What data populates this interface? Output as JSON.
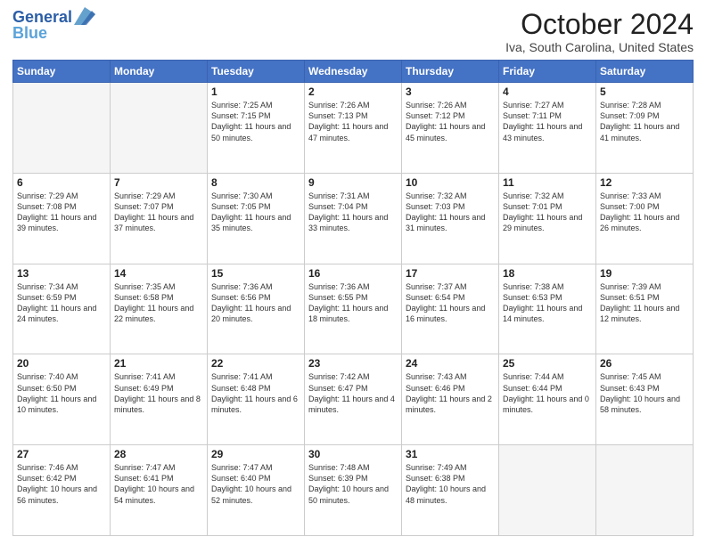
{
  "header": {
    "logo_line1": "General",
    "logo_line2": "Blue",
    "title": "October 2024",
    "subtitle": "Iva, South Carolina, United States"
  },
  "days_of_week": [
    "Sunday",
    "Monday",
    "Tuesday",
    "Wednesday",
    "Thursday",
    "Friday",
    "Saturday"
  ],
  "weeks": [
    [
      {
        "day": "",
        "sunrise": "",
        "sunset": "",
        "daylight": "",
        "empty": true
      },
      {
        "day": "",
        "sunrise": "",
        "sunset": "",
        "daylight": "",
        "empty": true
      },
      {
        "day": "1",
        "sunrise": "Sunrise: 7:25 AM",
        "sunset": "Sunset: 7:15 PM",
        "daylight": "Daylight: 11 hours and 50 minutes."
      },
      {
        "day": "2",
        "sunrise": "Sunrise: 7:26 AM",
        "sunset": "Sunset: 7:13 PM",
        "daylight": "Daylight: 11 hours and 47 minutes."
      },
      {
        "day": "3",
        "sunrise": "Sunrise: 7:26 AM",
        "sunset": "Sunset: 7:12 PM",
        "daylight": "Daylight: 11 hours and 45 minutes."
      },
      {
        "day": "4",
        "sunrise": "Sunrise: 7:27 AM",
        "sunset": "Sunset: 7:11 PM",
        "daylight": "Daylight: 11 hours and 43 minutes."
      },
      {
        "day": "5",
        "sunrise": "Sunrise: 7:28 AM",
        "sunset": "Sunset: 7:09 PM",
        "daylight": "Daylight: 11 hours and 41 minutes."
      }
    ],
    [
      {
        "day": "6",
        "sunrise": "Sunrise: 7:29 AM",
        "sunset": "Sunset: 7:08 PM",
        "daylight": "Daylight: 11 hours and 39 minutes."
      },
      {
        "day": "7",
        "sunrise": "Sunrise: 7:29 AM",
        "sunset": "Sunset: 7:07 PM",
        "daylight": "Daylight: 11 hours and 37 minutes."
      },
      {
        "day": "8",
        "sunrise": "Sunrise: 7:30 AM",
        "sunset": "Sunset: 7:05 PM",
        "daylight": "Daylight: 11 hours and 35 minutes."
      },
      {
        "day": "9",
        "sunrise": "Sunrise: 7:31 AM",
        "sunset": "Sunset: 7:04 PM",
        "daylight": "Daylight: 11 hours and 33 minutes."
      },
      {
        "day": "10",
        "sunrise": "Sunrise: 7:32 AM",
        "sunset": "Sunset: 7:03 PM",
        "daylight": "Daylight: 11 hours and 31 minutes."
      },
      {
        "day": "11",
        "sunrise": "Sunrise: 7:32 AM",
        "sunset": "Sunset: 7:01 PM",
        "daylight": "Daylight: 11 hours and 29 minutes."
      },
      {
        "day": "12",
        "sunrise": "Sunrise: 7:33 AM",
        "sunset": "Sunset: 7:00 PM",
        "daylight": "Daylight: 11 hours and 26 minutes."
      }
    ],
    [
      {
        "day": "13",
        "sunrise": "Sunrise: 7:34 AM",
        "sunset": "Sunset: 6:59 PM",
        "daylight": "Daylight: 11 hours and 24 minutes."
      },
      {
        "day": "14",
        "sunrise": "Sunrise: 7:35 AM",
        "sunset": "Sunset: 6:58 PM",
        "daylight": "Daylight: 11 hours and 22 minutes."
      },
      {
        "day": "15",
        "sunrise": "Sunrise: 7:36 AM",
        "sunset": "Sunset: 6:56 PM",
        "daylight": "Daylight: 11 hours and 20 minutes."
      },
      {
        "day": "16",
        "sunrise": "Sunrise: 7:36 AM",
        "sunset": "Sunset: 6:55 PM",
        "daylight": "Daylight: 11 hours and 18 minutes."
      },
      {
        "day": "17",
        "sunrise": "Sunrise: 7:37 AM",
        "sunset": "Sunset: 6:54 PM",
        "daylight": "Daylight: 11 hours and 16 minutes."
      },
      {
        "day": "18",
        "sunrise": "Sunrise: 7:38 AM",
        "sunset": "Sunset: 6:53 PM",
        "daylight": "Daylight: 11 hours and 14 minutes."
      },
      {
        "day": "19",
        "sunrise": "Sunrise: 7:39 AM",
        "sunset": "Sunset: 6:51 PM",
        "daylight": "Daylight: 11 hours and 12 minutes."
      }
    ],
    [
      {
        "day": "20",
        "sunrise": "Sunrise: 7:40 AM",
        "sunset": "Sunset: 6:50 PM",
        "daylight": "Daylight: 11 hours and 10 minutes."
      },
      {
        "day": "21",
        "sunrise": "Sunrise: 7:41 AM",
        "sunset": "Sunset: 6:49 PM",
        "daylight": "Daylight: 11 hours and 8 minutes."
      },
      {
        "day": "22",
        "sunrise": "Sunrise: 7:41 AM",
        "sunset": "Sunset: 6:48 PM",
        "daylight": "Daylight: 11 hours and 6 minutes."
      },
      {
        "day": "23",
        "sunrise": "Sunrise: 7:42 AM",
        "sunset": "Sunset: 6:47 PM",
        "daylight": "Daylight: 11 hours and 4 minutes."
      },
      {
        "day": "24",
        "sunrise": "Sunrise: 7:43 AM",
        "sunset": "Sunset: 6:46 PM",
        "daylight": "Daylight: 11 hours and 2 minutes."
      },
      {
        "day": "25",
        "sunrise": "Sunrise: 7:44 AM",
        "sunset": "Sunset: 6:44 PM",
        "daylight": "Daylight: 11 hours and 0 minutes."
      },
      {
        "day": "26",
        "sunrise": "Sunrise: 7:45 AM",
        "sunset": "Sunset: 6:43 PM",
        "daylight": "Daylight: 10 hours and 58 minutes."
      }
    ],
    [
      {
        "day": "27",
        "sunrise": "Sunrise: 7:46 AM",
        "sunset": "Sunset: 6:42 PM",
        "daylight": "Daylight: 10 hours and 56 minutes."
      },
      {
        "day": "28",
        "sunrise": "Sunrise: 7:47 AM",
        "sunset": "Sunset: 6:41 PM",
        "daylight": "Daylight: 10 hours and 54 minutes."
      },
      {
        "day": "29",
        "sunrise": "Sunrise: 7:47 AM",
        "sunset": "Sunset: 6:40 PM",
        "daylight": "Daylight: 10 hours and 52 minutes."
      },
      {
        "day": "30",
        "sunrise": "Sunrise: 7:48 AM",
        "sunset": "Sunset: 6:39 PM",
        "daylight": "Daylight: 10 hours and 50 minutes."
      },
      {
        "day": "31",
        "sunrise": "Sunrise: 7:49 AM",
        "sunset": "Sunset: 6:38 PM",
        "daylight": "Daylight: 10 hours and 48 minutes."
      },
      {
        "day": "",
        "sunrise": "",
        "sunset": "",
        "daylight": "",
        "empty": true
      },
      {
        "day": "",
        "sunrise": "",
        "sunset": "",
        "daylight": "",
        "empty": true
      }
    ]
  ]
}
